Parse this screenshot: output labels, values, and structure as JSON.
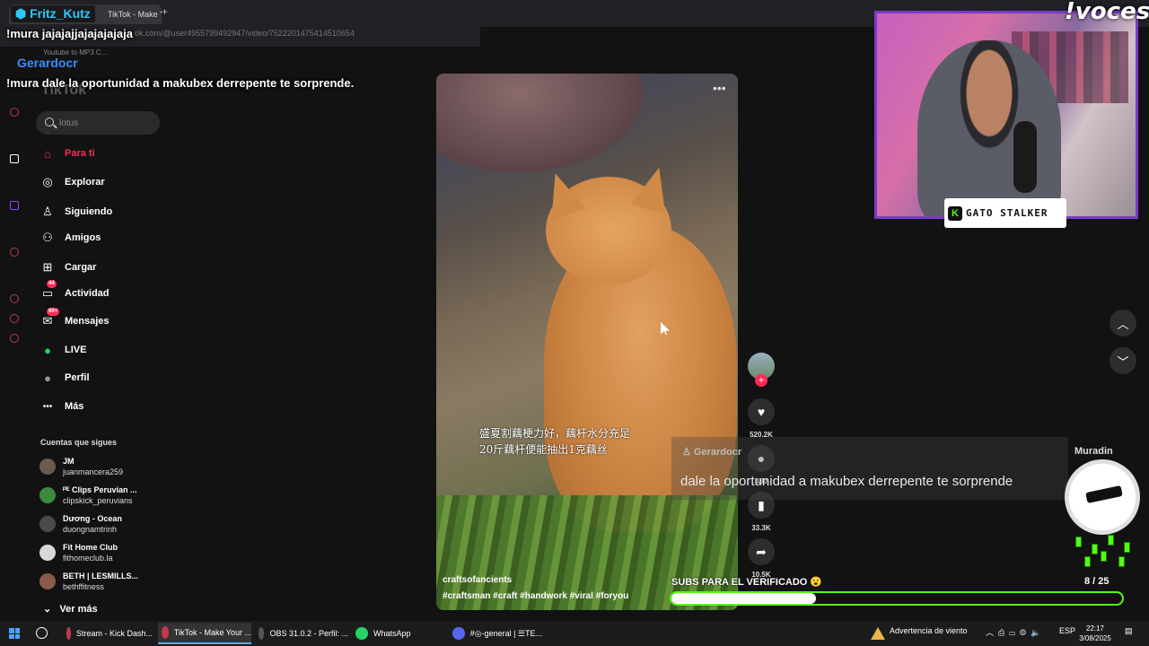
{
  "browser": {
    "tab_title": "TikTok - Make Your Da",
    "url": "ok.com/@user4955799492947/video/7522201475414510654",
    "bookmark": "Youtube to MP3 C..."
  },
  "chat": [
    {
      "user": "Fritz_Kutz",
      "user_color": "#2fc7ff",
      "message": "!mura jajajajjajajajajaja"
    },
    {
      "user": "Gerardocr",
      "user_color": "#3a8dff",
      "message": "!mura dale la oportunidad a makubex derrepente te sorprende."
    }
  ],
  "tiktok": {
    "logo": "TikTok",
    "search_placeholder": "lotus",
    "nav": [
      {
        "label": "Para ti",
        "icon": "home-icon",
        "glyph": "⌂",
        "badge": ""
      },
      {
        "label": "Explorar",
        "icon": "compass-icon",
        "glyph": "◎",
        "badge": ""
      },
      {
        "label": "Siguiendo",
        "icon": "user-follow-icon",
        "glyph": "♙",
        "badge": ""
      },
      {
        "label": "Amigos",
        "icon": "friends-icon",
        "glyph": "⚇",
        "badge": ""
      },
      {
        "label": "Cargar",
        "icon": "upload-icon",
        "glyph": "⊞",
        "badge": ""
      },
      {
        "label": "Actividad",
        "icon": "activity-icon",
        "glyph": "▭",
        "badge": "44"
      },
      {
        "label": "Mensajes",
        "icon": "messages-icon",
        "glyph": "✉",
        "badge": "99+"
      },
      {
        "label": "LIVE",
        "icon": "live-icon",
        "glyph": "●",
        "badge": ""
      },
      {
        "label": "Perfil",
        "icon": "profile-icon",
        "glyph": "●",
        "badge": ""
      },
      {
        "label": "Más",
        "icon": "more-icon",
        "glyph": "•••",
        "badge": ""
      }
    ],
    "following_title": "Cuentas que sigues",
    "accounts": [
      {
        "name": "JM",
        "handle": "juanmancera259"
      },
      {
        "name": "ᴾᴱ Clips Peruvian ...",
        "handle": "clipskick_peruvians"
      },
      {
        "name": "Dương - Ocean",
        "handle": "duongnamtrinh"
      },
      {
        "name": "Fit Home Club",
        "handle": "fithomeclub.la"
      },
      {
        "name": "BETH | LESMILLS...",
        "handle": "bethffitness"
      }
    ],
    "see_more": "Ver más"
  },
  "video": {
    "subtitle_line1": "盛夏割藕梗力好，藕杆水分充足",
    "subtitle_line2": "20斤藕杆便能抽出1克藕丝",
    "author": "craftsofancients",
    "tags": "#craftsman #craft #handwork #viral #foryou",
    "likes": "520.2K",
    "comments": "480",
    "saves": "33.3K",
    "shares": "10.5K"
  },
  "stream": {
    "brand": "!voces",
    "cam_label": "GATO STALKER",
    "overlay_user": "Gerardocr",
    "overlay_message": "dale la oportunidad a makubex derrepente te sorprende",
    "overlay_right_user": "Muradin",
    "goal_text": "SUBS PARA EL VERIFICADO 😮",
    "goal_count": "8 / 25",
    "goal_progress": 0.32,
    "kick_color": "#53fc18"
  },
  "taskbar": {
    "apps": [
      {
        "label": "Stream - Kick Dash...",
        "color": "#c0394b",
        "active": false
      },
      {
        "label": "TikTok - Make Your ...",
        "color": "#c0394b",
        "active": true
      },
      {
        "label": "OBS 31.0.2 - Perfil: ...",
        "color": "#555555",
        "active": false
      },
      {
        "label": "WhatsApp",
        "color": "#25d366",
        "active": false
      },
      {
        "label": "#◎-general | ☰TE...",
        "color": "#5865f2",
        "active": false
      }
    ],
    "weather": "Advertencia de viento",
    "lang": "ESP",
    "time": "22:17",
    "date": "3/08/2025"
  }
}
